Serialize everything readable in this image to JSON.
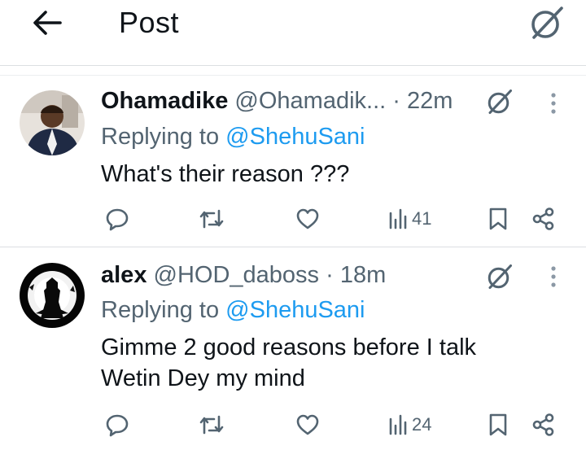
{
  "header": {
    "title": "Post"
  },
  "replies": [
    {
      "name": "Ohamadike",
      "handle": "@Ohamadik...",
      "separator": "·",
      "time": "22m",
      "replying_prefix": "Replying to",
      "replying_to": "@ShehuSani",
      "text_lines": [
        "What's their reason ???"
      ],
      "views": "41"
    },
    {
      "name": "alex",
      "handle": "@HOD_daboss",
      "separator": "·",
      "time": "18m",
      "replying_prefix": "Replying to",
      "replying_to": "@ShehuSani",
      "text_lines": [
        "Gimme 2 good reasons before I talk",
        "Wetin Dey my mind"
      ],
      "views": "24"
    }
  ],
  "icons": {
    "back": "arrow-left-icon",
    "grok": "grok-icon",
    "more": "more-vertical-icon",
    "reply": "reply-icon",
    "retweet": "retweet-icon",
    "like": "heart-icon",
    "views": "views-icon",
    "bookmark": "bookmark-icon",
    "share": "share-icon"
  },
  "colors": {
    "text": "#0f1419",
    "secondary": "#536471",
    "link": "#1d9bf0",
    "divider": "#dcdfe2"
  }
}
